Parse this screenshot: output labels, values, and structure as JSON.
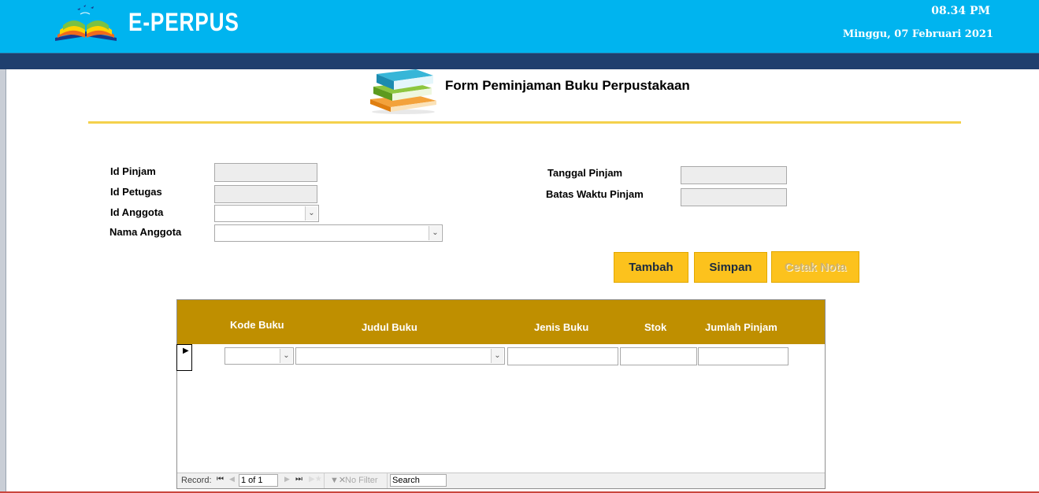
{
  "header": {
    "app_title": "E-PERPUS",
    "time": "08.34 PM",
    "date": "Minggu, 07 Februari 2021"
  },
  "form": {
    "title": "Form Peminjaman Buku Perpustakaan",
    "labels": {
      "id_pinjam": "Id Pinjam",
      "id_petugas": "Id Petugas",
      "id_anggota": "Id Anggota",
      "nama_anggota": "Nama Anggota",
      "tanggal_pinjam": "Tanggal Pinjam",
      "batas_waktu": "Batas Waktu Pinjam"
    },
    "values": {
      "id_pinjam": "",
      "id_petugas": "",
      "id_anggota": "",
      "nama_anggota": "",
      "tanggal_pinjam": "",
      "batas_waktu": ""
    }
  },
  "buttons": {
    "tambah": "Tambah",
    "simpan": "Simpan",
    "cetak_nota": "Cetak Nota"
  },
  "subform": {
    "columns": [
      "Kode Buku",
      "Judul Buku",
      "Jenis Buku",
      "Stok",
      "Jumlah Pinjam"
    ],
    "row": {
      "kode_buku": "",
      "judul_buku": "",
      "jenis_buku": "",
      "stok": "",
      "jumlah_pinjam": ""
    }
  },
  "navigation": {
    "record_label": "Record:",
    "record_position": "1 of 1",
    "filter_label": "No Filter",
    "search_placeholder": "Search"
  },
  "colors": {
    "header_bg": "#00b4ef",
    "dark_bar": "#1f3f6e",
    "title_rule": "#f4d14c",
    "button_bg": "#fcc21d",
    "subform_header": "#bf8f00"
  },
  "icons": [
    "open-book-logo-icon",
    "stacked-books-icon",
    "record-pointer-icon",
    "first-record-icon",
    "previous-record-icon",
    "next-record-icon",
    "last-record-icon",
    "new-record-icon",
    "filter-icon",
    "chevron-down-icon"
  ]
}
